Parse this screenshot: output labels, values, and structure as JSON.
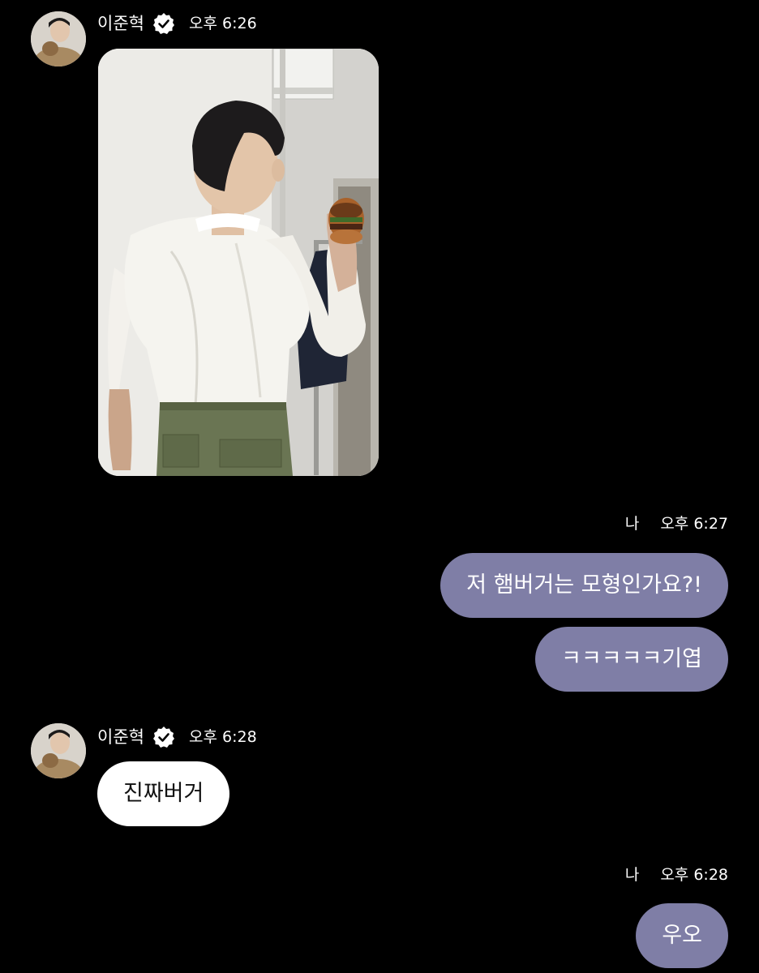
{
  "thread": {
    "counterpart_name": "이준혁",
    "my_label": "나",
    "colors": {
      "background": "#000000",
      "my_bubble": "#7f7ea6",
      "their_bubble": "#ffffff"
    }
  },
  "messages": [
    {
      "sender": "이준혁",
      "time": "오후 6:26",
      "type": "image",
      "image": "photo-man-holding-hamburger"
    },
    {
      "sender": "나",
      "time": "오후 6:27",
      "type": "text",
      "texts": [
        "저 햄버거는 모형인가요?!",
        "ㅋㅋㅋㅋㅋ기엽"
      ]
    },
    {
      "sender": "이준혁",
      "time": "오후 6:28",
      "type": "text",
      "texts": [
        "진짜버거"
      ]
    },
    {
      "sender": "나",
      "time": "오후 6:28",
      "type": "text",
      "texts": [
        "우오"
      ]
    }
  ],
  "icons": {
    "verified": "verified-check-badge-icon",
    "avatar": "profile-avatar"
  }
}
